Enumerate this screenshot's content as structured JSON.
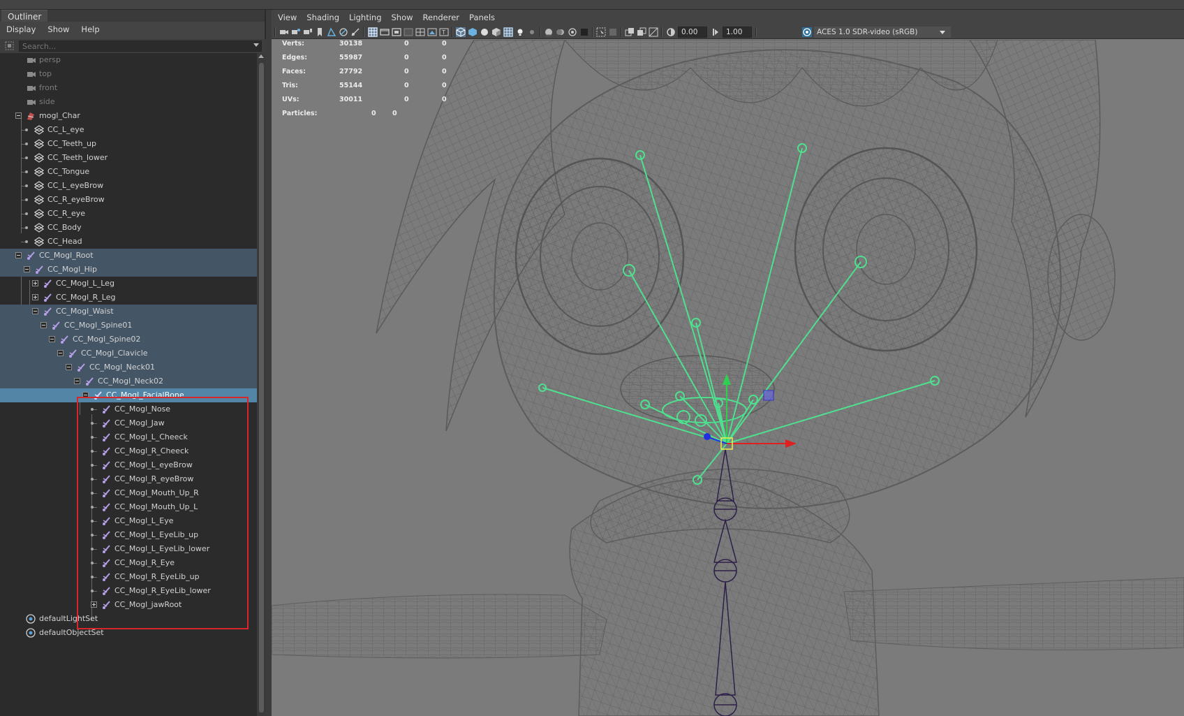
{
  "outliner": {
    "tab": "Outliner",
    "menu": [
      "Display",
      "Show",
      "Help"
    ],
    "search_placeholder": "Search...",
    "items": [
      {
        "label": "persp",
        "dim": true,
        "icon": "camera-icon"
      },
      {
        "label": "top",
        "dim": true,
        "icon": "camera-icon"
      },
      {
        "label": "front",
        "dim": true,
        "icon": "camera-icon"
      },
      {
        "label": "side",
        "dim": true,
        "icon": "camera-icon"
      },
      {
        "label": "mogl_Char",
        "icon": "set-group-icon"
      },
      {
        "label": "CC_L_eye",
        "icon": "mesh-transform-icon"
      },
      {
        "label": "CC_Teeth_up",
        "icon": "mesh-transform-icon"
      },
      {
        "label": "CC_Teeth_lower",
        "icon": "mesh-transform-icon"
      },
      {
        "label": "CC_Tongue",
        "icon": "mesh-transform-icon"
      },
      {
        "label": "CC_L_eyeBrow",
        "icon": "mesh-transform-icon"
      },
      {
        "label": "CC_R_eyeBrow",
        "icon": "mesh-transform-icon"
      },
      {
        "label": "CC_R_eye",
        "icon": "mesh-transform-icon"
      },
      {
        "label": "CC_Body",
        "icon": "mesh-transform-icon"
      },
      {
        "label": "CC_Head",
        "icon": "mesh-transform-icon"
      },
      {
        "label": "CC_Mogl_Root",
        "icon": "joint-icon"
      },
      {
        "label": "CC_Mogl_Hip",
        "icon": "joint-icon"
      },
      {
        "label": "CC_Mogl_L_Leg",
        "icon": "joint-icon"
      },
      {
        "label": "CC_Mogl_R_Leg",
        "icon": "joint-icon"
      },
      {
        "label": "CC_Mogl_Waist",
        "icon": "joint-icon"
      },
      {
        "label": "CC_Mogl_Spine01",
        "icon": "joint-icon"
      },
      {
        "label": "CC_Mogl_Spine02",
        "icon": "joint-icon"
      },
      {
        "label": "CC_Mogl_Clavicle",
        "icon": "joint-icon"
      },
      {
        "label": "CC_Mogl_Neck01",
        "icon": "joint-icon"
      },
      {
        "label": "CC_Mogl_Neck02",
        "icon": "joint-icon"
      },
      {
        "label": "CC_Mogl_FacialBone",
        "icon": "joint-icon"
      },
      {
        "label": "CC_Mogl_Nose",
        "icon": "joint-icon"
      },
      {
        "label": "CC_Mogl_Jaw",
        "icon": "joint-icon"
      },
      {
        "label": "CC_Mogl_L_Cheeck",
        "icon": "joint-icon"
      },
      {
        "label": "CC_Mogl_R_Cheeck",
        "icon": "joint-icon"
      },
      {
        "label": "CC_Mogl_L_eyeBrow",
        "icon": "joint-icon"
      },
      {
        "label": "CC_Mogl_R_eyeBrow",
        "icon": "joint-icon"
      },
      {
        "label": "CC_Mogl_Mouth_Up_R",
        "icon": "joint-icon"
      },
      {
        "label": "CC_Mogl_Mouth_Up_L",
        "icon": "joint-icon"
      },
      {
        "label": "CC_Mogl_L_Eye",
        "icon": "joint-icon"
      },
      {
        "label": "CC_Mogl_L_EyeLib_up",
        "icon": "joint-icon"
      },
      {
        "label": "CC_Mogl_L_EyeLib_lower",
        "icon": "joint-icon"
      },
      {
        "label": "CC_Mogl_R_Eye",
        "icon": "joint-icon"
      },
      {
        "label": "CC_Mogl_R_EyeLib_up",
        "icon": "joint-icon"
      },
      {
        "label": "CC_Mogl_R_EyeLib_lower",
        "icon": "joint-icon"
      },
      {
        "label": "CC_Mogl_jawRoot",
        "icon": "joint-icon"
      },
      {
        "label": "defaultLightSet",
        "icon": "object-set-icon"
      },
      {
        "label": "defaultObjectSet",
        "icon": "object-set-icon"
      }
    ]
  },
  "viewport": {
    "menu": [
      "View",
      "Shading",
      "Lighting",
      "Show",
      "Renderer",
      "Panels"
    ],
    "exposure": "0.00",
    "gamma": "1.00",
    "color_space": "ACES 1.0 SDR-video (sRGB)",
    "hud": [
      {
        "label": "Verts:",
        "values": [
          "30138",
          "0",
          "0"
        ]
      },
      {
        "label": "Edges:",
        "values": [
          "55987",
          "0",
          "0"
        ]
      },
      {
        "label": "Faces:",
        "values": [
          "27792",
          "0",
          "0"
        ]
      },
      {
        "label": "Tris:",
        "values": [
          "55144",
          "0",
          "0"
        ]
      },
      {
        "label": "UVs:",
        "values": [
          "30011",
          "0",
          "0"
        ]
      },
      {
        "label": "Particles:",
        "values": [
          "0",
          "0"
        ]
      }
    ],
    "colors": {
      "viewport_bg": "#7b7b7b",
      "wire": "#5f5f5f",
      "joint_green": "#4fe08f",
      "selection": "#5285a6",
      "highlight_box": "#d8262d"
    }
  }
}
